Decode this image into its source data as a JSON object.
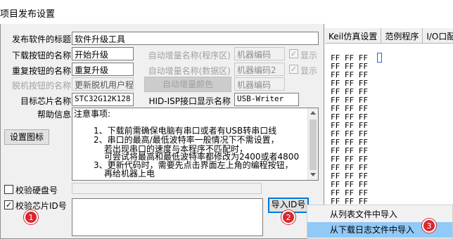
{
  "dialog": {
    "title": "项目发布设置"
  },
  "background": {
    "tabs": [
      "Keil仿真设置",
      "范例程序",
      "I/O口配"
    ],
    "hex_rows": [
      "FF FF FF",
      "FF FF FF",
      "FF FF FF",
      "FF FF FF",
      "FF FF FF",
      "FF FF FF",
      "FF FF FF",
      "FF FF FF",
      "FF FF FF",
      "FF FF FF",
      "FF FF FF",
      "FF FF FF",
      "FF FF FF",
      "FF FF FF",
      "FF FF FF",
      "FF FF FF",
      "FF FF FF",
      "FF FF FF",
      "FF FF FF",
      "FF FF",
      "FF FF"
    ]
  },
  "form": {
    "release_title_label": "发布软件的标题",
    "release_title_value": "软件升级工具",
    "download_label": "下载按钮的名称",
    "download_value": "开始升级",
    "redownload_label": "重复按钮的名称",
    "redownload_value": "重复升级",
    "offline_label": "脱机按钮的名称",
    "offline_value": "更新脱机用户程序",
    "auto_prog_label": "自动增量名称(程序区)",
    "auto_prog_value": "机器编码",
    "auto_data_label": "自动增量名称(数据区)",
    "auto_data_value": "机器编码2",
    "auto_color_button": "自动增量颜色",
    "auto_color_value": "机器编码",
    "show_label": "显示",
    "show_check": "✓",
    "chip_label": "目标芯片名称",
    "chip_value": "STC32G12K128",
    "hid_label": "HID-ISP接口显示名称",
    "hid_value": "USB-Writer",
    "help_label": "帮助信息",
    "help_lines": [
      "注意事项:",
      "1、下载前需确保电脑有串口或者有USB转串口线",
      "2、串口的最高/最低波特率一般情况下不需设置，",
      "若出现串口的速度与本程序不匹配时，",
      "可尝试将最高和最低波特率都修改为2400或者4800",
      "3、更新代码时，需要先点击界面左上角的编程按钮，",
      "再给机器上电"
    ],
    "set_icon_button": "设置图标",
    "verify_disk_label": "校验硬盘号",
    "verify_chipid_label": "校验芯片ID号",
    "verify_chipid_check": "✓",
    "import_id_button": "导入ID号"
  },
  "context_menu": {
    "items": [
      "从列表文件中导入",
      "从下载日志文件中导入"
    ]
  },
  "badges": [
    "1",
    "2",
    "3"
  ],
  "colors": {
    "badge": "#d8282f",
    "menu_highlight": "#91c9f7",
    "focus": "#0078d7"
  }
}
